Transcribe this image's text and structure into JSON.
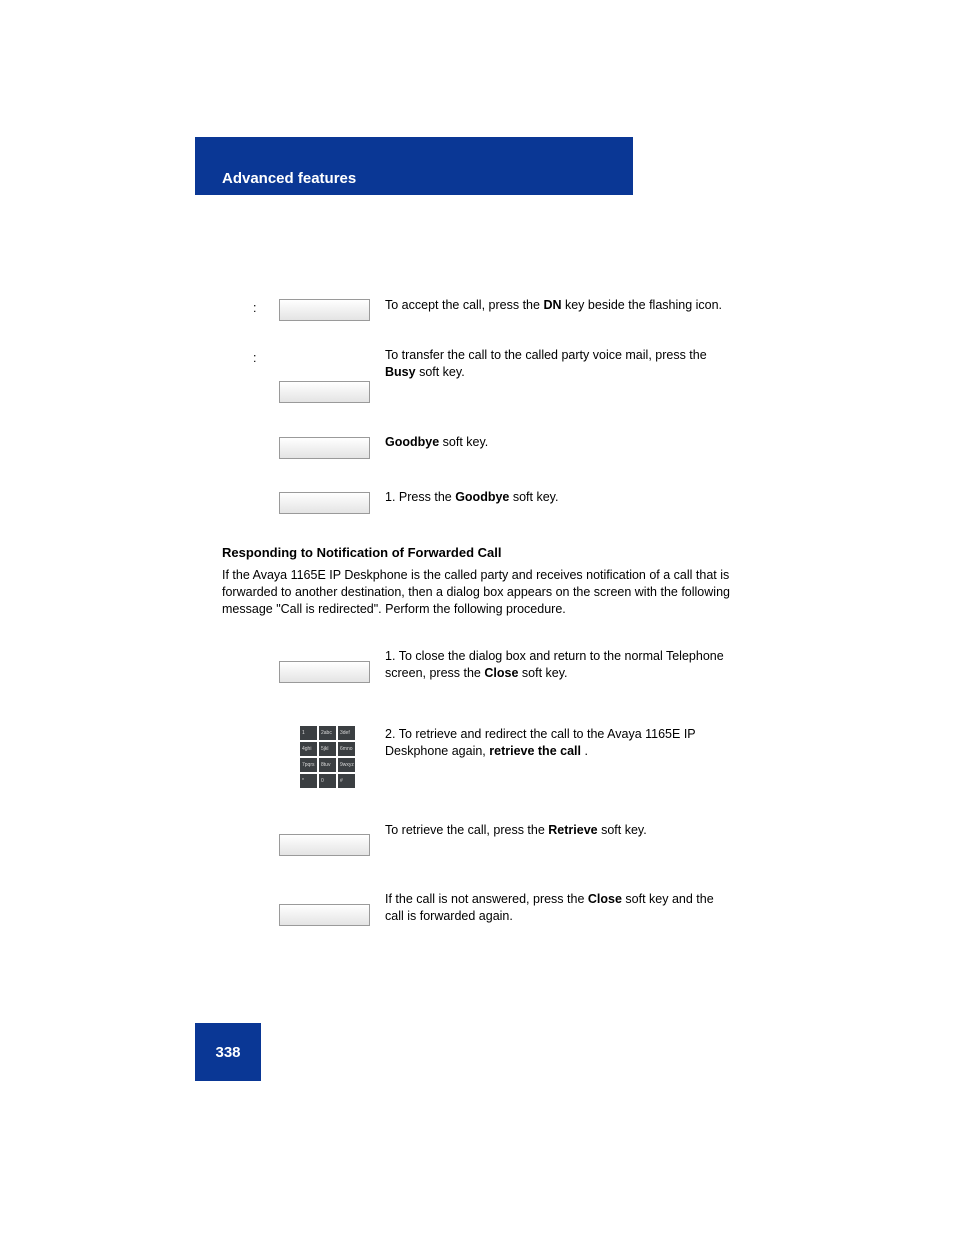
{
  "header": {
    "title": "Advanced features"
  },
  "page_number": "338",
  "row1": {
    "left": ":",
    "right1": "To accept the call, press the",
    "key": "DN",
    "right2": "key beside the flashing icon."
  },
  "row2": {
    "left": ":",
    "right1": "To transfer the call to the called party voice mail, press the",
    "key": "Busy",
    "right2": "soft key."
  },
  "row3": {
    "step1": {
      "key": "Goodbye",
      "text": "soft key."
    },
    "step2": {
      "label": "1.",
      "text_pre": "Press the ",
      "key": "Goodbye",
      "text_post": " soft key."
    }
  },
  "section_heading": "Responding to Notification of Forwarded Call",
  "section_intro": "If the Avaya 1165E IP Deskphone is the called party and receives notification of a call that is forwarded to another destination, then a dialog box appears on the screen with the following message \"Call is redirected\". Perform the following procedure.",
  "fwd_steps": {
    "s1": {
      "label": "1.",
      "text_pre": "To close the dialog box and return to the normal Telephone screen, press the ",
      "key": "Close",
      "text_post": " soft key."
    },
    "s2": {
      "label": "2.",
      "text_pre": "To retrieve and redirect the call to the Avaya 1165E IP Deskphone again, ",
      "key": "retrieve the call",
      "text_post": "."
    },
    "s3": {
      "text_pre": "To retrieve the call, press the ",
      "key": "Retrieve",
      "text_post": " soft key."
    },
    "s4": {
      "text_pre": "If the call is not answered, press the ",
      "key": "Close",
      "text_post": " soft key and the call is forwarded again."
    }
  },
  "dialpad": [
    [
      "1",
      "2abc",
      "3def"
    ],
    [
      "4ghi",
      "5jkl",
      "6mno"
    ],
    [
      "7pqrs",
      "8tuv",
      "9wxyz"
    ],
    [
      "*",
      "0",
      "#"
    ]
  ]
}
